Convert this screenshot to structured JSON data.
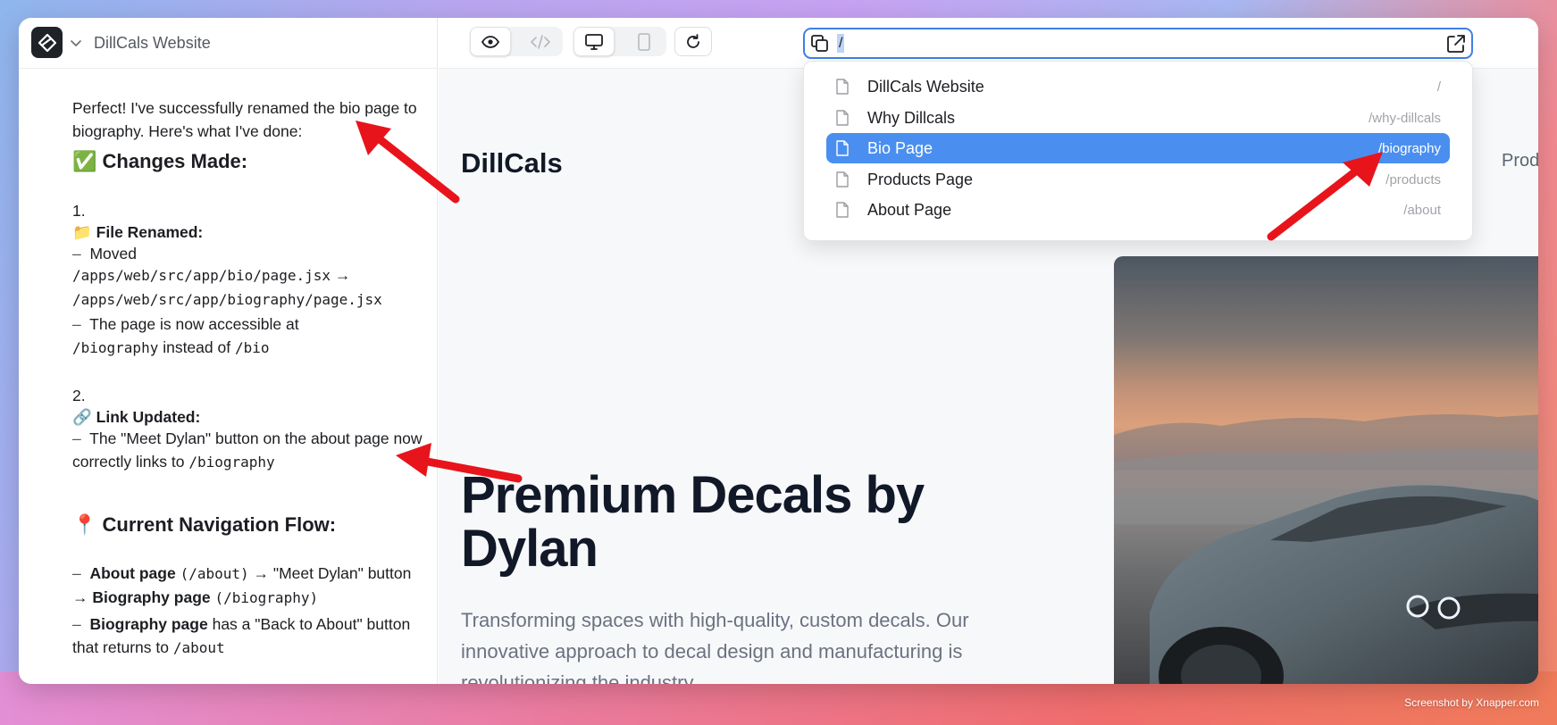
{
  "project": {
    "title": "DillCals Website"
  },
  "chat": {
    "intro": "Perfect! I've successfully renamed the bio page to biography. Here's what I've done:",
    "changes_heading": "✅ Changes Made:",
    "item1_number": "1.",
    "item1_title": "📁 File Renamed:",
    "item1_moved_label": "Moved",
    "item1_from": "/apps/web/src/app/bio/page.jsx",
    "item1_arrow": "→",
    "item1_to": "/apps/web/src/app/biography/page.jsx",
    "item1_access_pre": "The page is now accessible at",
    "item1_access_new": "/biography",
    "item1_access_mid": "instead of",
    "item1_access_old": "/bio",
    "item2_number": "2.",
    "item2_title": "🔗 Link Updated:",
    "item2_text_pre": "The \"Meet Dylan\" button on the about page now correctly links to",
    "item2_text_path": "/biography",
    "nav_heading": "📍 Current Navigation Flow:",
    "flow1_a": "About page",
    "flow1_a_path": "(/about)",
    "flow1_mid": "→ \"Meet Dylan\" button →",
    "flow1_b": "Biography page",
    "flow1_b_path": "(/biography)",
    "flow2_a": "Biography page",
    "flow2_mid": "has a \"Back to About\" button that returns to",
    "flow2_path": "/about",
    "dash": "–"
  },
  "url_bar": {
    "value": "/"
  },
  "routes": [
    {
      "label": "DillCals Website",
      "path": "/",
      "selected": false
    },
    {
      "label": "Why Dillcals",
      "path": "/why-dillcals",
      "selected": false
    },
    {
      "label": "Bio Page",
      "path": "/biography",
      "selected": true
    },
    {
      "label": "Products Page",
      "path": "/products",
      "selected": false
    },
    {
      "label": "About Page",
      "path": "/about",
      "selected": false
    }
  ],
  "site": {
    "brand": "DillCals",
    "nav_partial": "Prod",
    "hero_title": "Premium Decals by Dylan",
    "hero_subtitle": "Transforming spaces with high-quality, custom decals. Our innovative approach to decal design and manufacturing is revolutionizing the industry."
  },
  "watermark": "Screenshot by Xnapper.com",
  "colors": {
    "accent": "#4a8ff0",
    "url_border": "#3f7fe6",
    "arrow": "#e8141b"
  },
  "icons": {
    "logo": "app-logo-icon",
    "view": "eye-icon",
    "code": "code-icon",
    "desktop": "monitor-icon",
    "mobile": "phone-icon",
    "refresh": "refresh-icon",
    "copy": "copy-icon",
    "open": "external-link-icon",
    "page": "file-icon"
  }
}
